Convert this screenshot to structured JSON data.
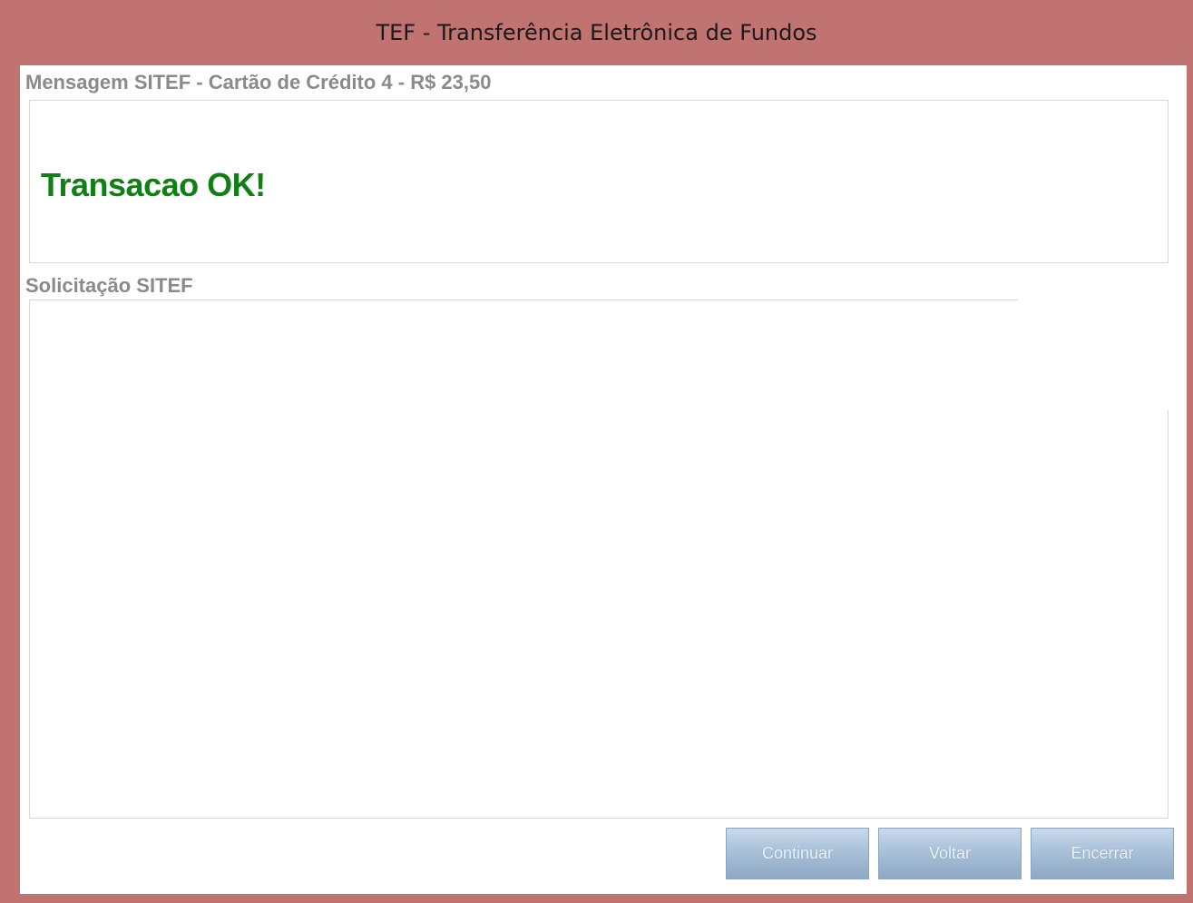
{
  "window": {
    "title": "TEF - Transferência Eletrônica de Fundos"
  },
  "message": {
    "label": "Mensagem SITEF - Cartão de Crédito 4 - R$ 23,50",
    "text": "Transacao OK!"
  },
  "request": {
    "label": "Solicitação SITEF"
  },
  "buttons": {
    "continue_label": "Continuar",
    "back_label": "Voltar",
    "finish_label": "Encerrar"
  },
  "colors": {
    "window_frame": "#c07370",
    "success_text": "#118014",
    "button_fill": "#a9c1d9"
  }
}
